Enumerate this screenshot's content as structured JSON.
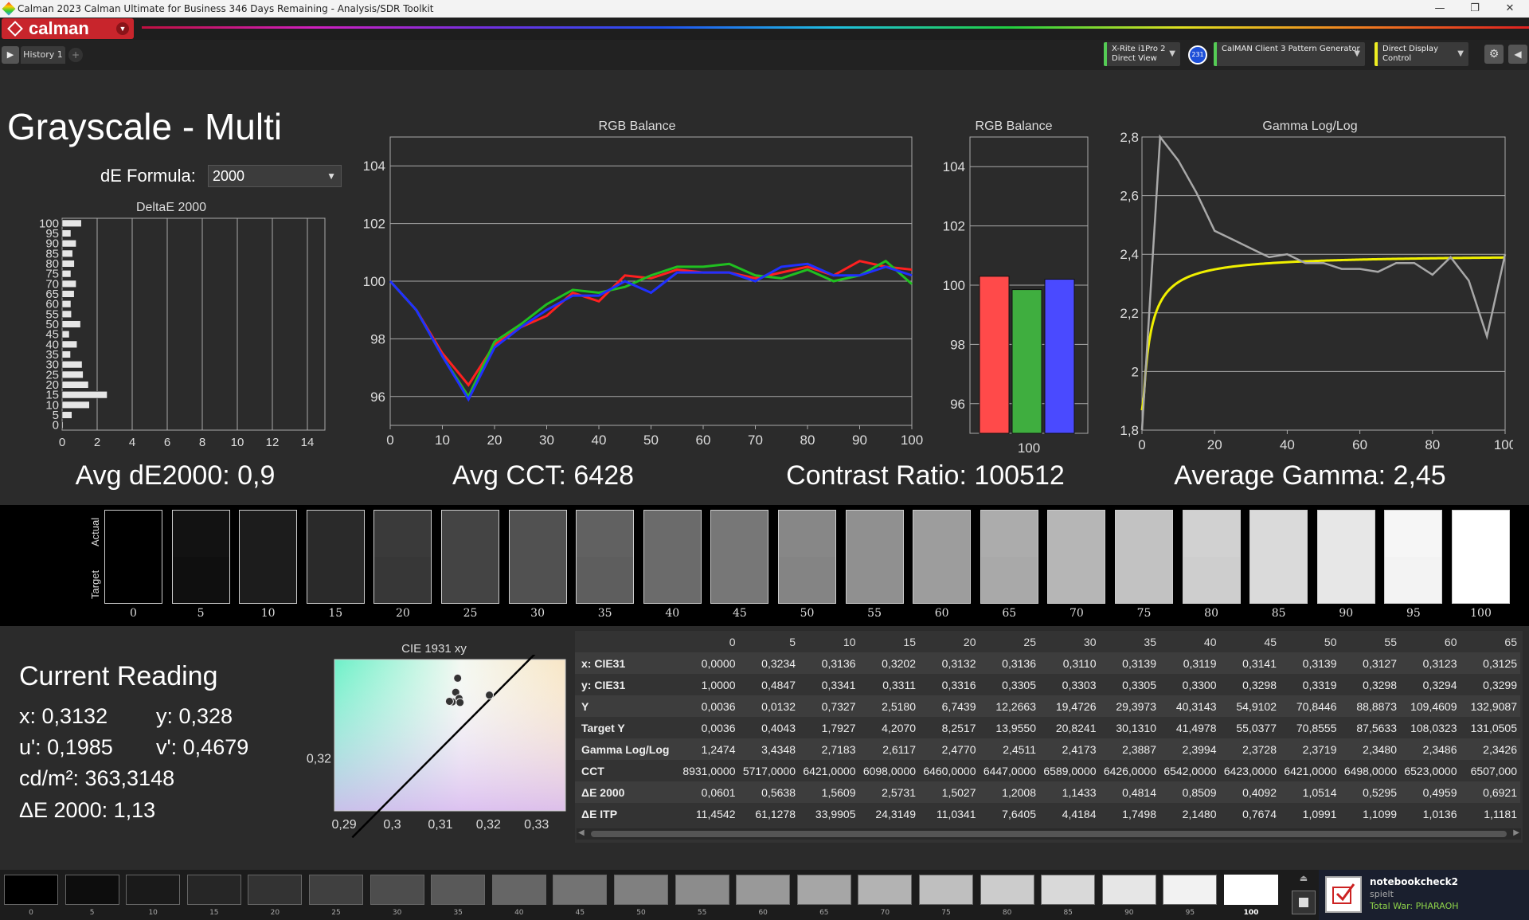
{
  "window": {
    "title": "Calman 2023 Calman Ultimate for Business 346 Days Remaining  - Analysis/SDR Toolkit",
    "minimize": "—",
    "restore": "❐",
    "close": "✕"
  },
  "app": {
    "logo_text": "calman",
    "logo_dropdown": "▼"
  },
  "tabs": {
    "play": "▶",
    "history_label": "History 1",
    "add": "+"
  },
  "devices": {
    "probe_line1": "X-Rite i1Pro 2",
    "probe_line2": "Direct View",
    "probe_badge": "231",
    "pattern": "CalMAN Client 3 Pattern Generator",
    "display": "Direct Display Control",
    "gear_icon": "⚙",
    "collapse_icon": "◀",
    "dropdown_arrow": "▼"
  },
  "page": {
    "title": "Grayscale - Multi",
    "de_formula_label": "dE Formula:",
    "de_formula_value": "2000"
  },
  "stats": {
    "avg_de": "Avg dE2000: 0,9",
    "avg_cct": "Avg CCT: 6428",
    "contrast": "Contrast Ratio: 100512",
    "avg_gamma": "Average Gamma: 2,45"
  },
  "swatches": {
    "actual_label": "Actual",
    "target_label": "Target",
    "levels": [
      "0",
      "5",
      "10",
      "15",
      "20",
      "25",
      "30",
      "35",
      "40",
      "45",
      "50",
      "55",
      "60",
      "65",
      "70",
      "75",
      "80",
      "85",
      "90",
      "95",
      "100"
    ]
  },
  "current_reading": {
    "title": "Current Reading",
    "x": "x: 0,3132",
    "y": "y: 0,328",
    "u": "u': 0,1985",
    "v": "v': 0,4679",
    "cdm2": "cd/m²: 363,3148",
    "de": "ΔE 2000: 1,13"
  },
  "table": {
    "columns": [
      "",
      "0",
      "5",
      "10",
      "15",
      "20",
      "25",
      "30",
      "35",
      "40",
      "45",
      "50",
      "55",
      "60",
      "65"
    ],
    "rows": [
      [
        "x: CIE31",
        "0,0000",
        "0,3234",
        "0,3136",
        "0,3202",
        "0,3132",
        "0,3136",
        "0,3110",
        "0,3139",
        "0,3119",
        "0,3141",
        "0,3139",
        "0,3127",
        "0,3123",
        "0,3125"
      ],
      [
        "y: CIE31",
        "1,0000",
        "0,4847",
        "0,3341",
        "0,3311",
        "0,3316",
        "0,3305",
        "0,3303",
        "0,3305",
        "0,3300",
        "0,3298",
        "0,3319",
        "0,3298",
        "0,3294",
        "0,3299"
      ],
      [
        "Y",
        "0,0036",
        "0,0132",
        "0,7327",
        "2,5180",
        "6,7439",
        "12,2663",
        "19,4726",
        "29,3973",
        "40,3143",
        "54,9102",
        "70,8446",
        "88,8873",
        "109,4609",
        "132,9087"
      ],
      [
        "Target Y",
        "0,0036",
        "0,4043",
        "1,7927",
        "4,2070",
        "8,2517",
        "13,9550",
        "20,8241",
        "30,1310",
        "41,4978",
        "55,0377",
        "70,8555",
        "87,5633",
        "108,0323",
        "131,0505"
      ],
      [
        "Gamma Log/Log",
        "1,2474",
        "3,4348",
        "2,7183",
        "2,6117",
        "2,4770",
        "2,4511",
        "2,4173",
        "2,3887",
        "2,3994",
        "2,3728",
        "2,3719",
        "2,3480",
        "2,3486",
        "2,3426"
      ],
      [
        "CCT",
        "8931,0000",
        "5717,0000",
        "6421,0000",
        "6098,0000",
        "6460,0000",
        "6447,0000",
        "6589,0000",
        "6426,0000",
        "6542,0000",
        "6423,0000",
        "6421,0000",
        "6498,0000",
        "6523,0000",
        "6507,000"
      ],
      [
        "ΔE 2000",
        "0,0601",
        "0,5638",
        "1,5609",
        "2,5731",
        "1,5027",
        "1,2008",
        "1,1433",
        "0,4814",
        "0,8509",
        "0,4092",
        "1,0514",
        "0,5295",
        "0,4959",
        "0,6921"
      ],
      [
        "ΔE ITP",
        "11,4542",
        "61,1278",
        "33,9905",
        "24,3149",
        "11,0341",
        "7,6405",
        "4,4184",
        "1,7498",
        "2,1480",
        "0,7674",
        "1,0991",
        "1,1099",
        "1,0136",
        "1,1181"
      ]
    ],
    "scroll_left": "◀",
    "scroll_right": "▶"
  },
  "bottom_strip": {
    "levels": [
      "0",
      "5",
      "10",
      "15",
      "20",
      "25",
      "30",
      "35",
      "40",
      "45",
      "50",
      "55",
      "60",
      "65",
      "70",
      "75",
      "80",
      "85",
      "90",
      "95",
      "100"
    ]
  },
  "notification": {
    "user": "notebookcheck2",
    "status": "spielt",
    "game": "Total War: PHARAOH"
  },
  "chart_data": [
    {
      "type": "bar",
      "title": "DeltaE 2000",
      "orientation": "horizontal",
      "categories": [
        0,
        5,
        10,
        15,
        20,
        25,
        30,
        35,
        40,
        45,
        50,
        55,
        60,
        65,
        70,
        75,
        80,
        85,
        90,
        95,
        100
      ],
      "values": [
        0.06,
        0.56,
        1.56,
        2.57,
        1.5,
        1.2,
        1.14,
        0.48,
        0.85,
        0.41,
        1.05,
        0.53,
        0.5,
        0.69,
        0.8,
        0.5,
        0.7,
        0.6,
        0.8,
        0.5,
        1.1
      ],
      "xlim": [
        0,
        15
      ],
      "xticks": [
        "0",
        "2",
        "4",
        "6",
        "8",
        "10",
        "12",
        "14"
      ],
      "yticks": [
        "0",
        "5",
        "10",
        "15",
        "20",
        "25",
        "30",
        "35",
        "40",
        "45",
        "50",
        "55",
        "60",
        "65",
        "70",
        "75",
        "80",
        "85",
        "90",
        "95",
        "100"
      ]
    },
    {
      "type": "line",
      "title": "RGB Balance",
      "x": [
        0,
        5,
        10,
        15,
        20,
        25,
        30,
        35,
        40,
        45,
        50,
        55,
        60,
        65,
        70,
        75,
        80,
        85,
        90,
        95,
        100
      ],
      "series": [
        {
          "color": "#ff2020",
          "values": [
            100,
            99.0,
            97.5,
            96.4,
            97.8,
            98.4,
            98.8,
            99.6,
            99.3,
            100.2,
            100.1,
            100.4,
            100.3,
            100.3,
            100.1,
            100.3,
            100.5,
            100.2,
            100.7,
            100.5,
            100.4
          ]
        },
        {
          "color": "#20c020",
          "values": [
            100,
            99.0,
            97.4,
            96.0,
            97.9,
            98.5,
            99.2,
            99.7,
            99.6,
            99.8,
            100.2,
            100.5,
            100.5,
            100.6,
            100.2,
            100.1,
            100.4,
            100.0,
            100.2,
            100.7,
            99.9
          ]
        },
        {
          "color": "#2030ff",
          "values": [
            100,
            99.0,
            97.4,
            95.9,
            97.7,
            98.4,
            99.0,
            99.5,
            99.5,
            100.0,
            99.6,
            100.3,
            100.3,
            100.3,
            100.0,
            100.5,
            100.6,
            100.2,
            100.2,
            100.5,
            100.2
          ]
        }
      ],
      "xlim": [
        0,
        100
      ],
      "ylim": [
        95,
        105
      ],
      "xticks": [
        "0",
        "10",
        "20",
        "30",
        "40",
        "50",
        "60",
        "70",
        "80",
        "90",
        "100"
      ],
      "yticks": [
        "96",
        "98",
        "100",
        "102",
        "104"
      ]
    },
    {
      "type": "bar",
      "title": "RGB Balance",
      "categories": [
        "100"
      ],
      "series": [
        {
          "color": "#ff4a4a",
          "values": [
            100.3
          ]
        },
        {
          "color": "#3fae3f",
          "values": [
            99.85
          ]
        },
        {
          "color": "#4a4aff",
          "values": [
            100.2
          ]
        }
      ],
      "ylim": [
        95,
        105
      ],
      "yticks": [
        "96",
        "98",
        "100",
        "102",
        "104"
      ]
    },
    {
      "type": "line",
      "title": "Gamma Log/Log",
      "x_measured": [
        0,
        5,
        10,
        15,
        20,
        25,
        30,
        35,
        40,
        45,
        50,
        55,
        60,
        65,
        70,
        75,
        80,
        85,
        90,
        95,
        100
      ],
      "measured": [
        1.25,
        2.8,
        2.72,
        2.61,
        2.48,
        2.45,
        2.42,
        2.39,
        2.4,
        2.37,
        2.37,
        2.35,
        2.35,
        2.34,
        2.37,
        2.37,
        2.33,
        2.39,
        2.31,
        2.12,
        2.4
      ],
      "target_gamma_asymptote": 2.4,
      "measured_color": "#a8a8a8",
      "target_color": "#f0f000",
      "xlim": [
        0,
        100
      ],
      "ylim": [
        1.8,
        2.8
      ],
      "xticks": [
        "0",
        "20",
        "40",
        "60",
        "80",
        "100"
      ],
      "yticks": [
        "1,8",
        "2",
        "2,2",
        "2,4",
        "2,6",
        "2,8"
      ]
    },
    {
      "type": "scatter",
      "title": "CIE 1931 xy",
      "points": [
        [
          0.3125,
          0.3299
        ],
        [
          0.3132,
          0.3316
        ],
        [
          0.3139,
          0.3305
        ],
        [
          0.3136,
          0.3341
        ],
        [
          0.3141,
          0.3298
        ],
        [
          0.3119,
          0.33
        ],
        [
          0.3202,
          0.3311
        ]
      ],
      "planckian": [
        [
          0.2917,
          0.3059
        ],
        [
          0.3305,
          0.3391
        ]
      ],
      "xlim": [
        0.288,
        0.336
      ],
      "ylim": [
        0.3106,
        0.3374
      ],
      "xticks": [
        "0,29",
        "0,3",
        "0,31",
        "0,32",
        "0,33"
      ],
      "yticks": [
        "0,32",
        "0,34"
      ]
    }
  ]
}
